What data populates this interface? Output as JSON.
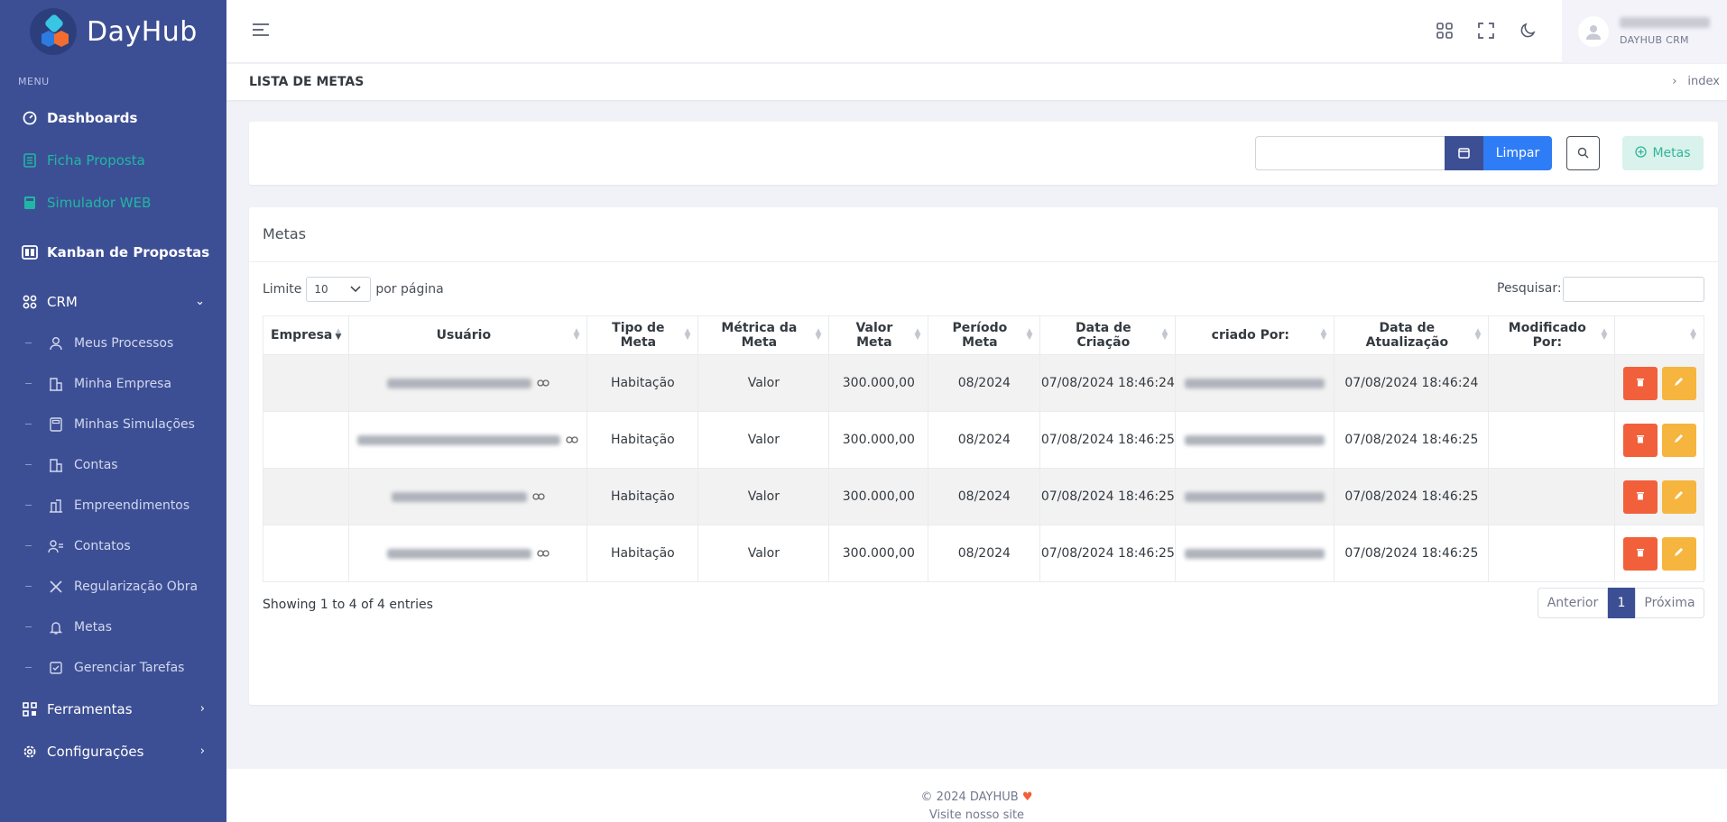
{
  "brand": {
    "name": "DayHub"
  },
  "sidebar": {
    "menu_title": "MENU",
    "items": [
      {
        "label": "Dashboards"
      },
      {
        "label": "Ficha Proposta"
      },
      {
        "label": "Simulador WEB"
      },
      {
        "label": "Kanban de Propostas"
      },
      {
        "label": "CRM"
      }
    ],
    "crm_sub": [
      {
        "label": "Meus Processos"
      },
      {
        "label": "Minha Empresa"
      },
      {
        "label": "Minhas Simulações"
      },
      {
        "label": "Contas"
      },
      {
        "label": "Empreendimentos"
      },
      {
        "label": "Contatos"
      },
      {
        "label": "Regularização Obra"
      },
      {
        "label": "Metas"
      },
      {
        "label": "Gerenciar Tarefas"
      }
    ],
    "bottom": [
      {
        "label": "Ferramentas"
      },
      {
        "label": "Configurações"
      }
    ]
  },
  "header": {
    "user_role": "DAYHUB CRM"
  },
  "breadcrumb": {
    "title": "LISTA DE METAS",
    "current": "index"
  },
  "filter": {
    "clear_label": "Limpar",
    "add_label": "Metas"
  },
  "table_card": {
    "title": "Metas",
    "limit_label": "Limite",
    "limit_value": "10",
    "per_page_label": "por página",
    "search_label": "Pesquisar:",
    "columns": [
      "Empresa",
      "Usuário",
      "Tipo de Meta",
      "Métrica da Meta",
      "Valor Meta",
      "Período Meta",
      "Data de Criação",
      "criado Por:",
      "Data de Atualização",
      "Modificado Por:",
      ""
    ],
    "rows": [
      {
        "tipo": "Habitação",
        "metrica": "Valor",
        "valor": "300.000,00",
        "periodo": "08/2024",
        "criacao": "07/08/2024 18:46:24",
        "atualizacao": "07/08/2024 18:46:24"
      },
      {
        "tipo": "Habitação",
        "metrica": "Valor",
        "valor": "300.000,00",
        "periodo": "08/2024",
        "criacao": "07/08/2024 18:46:25",
        "atualizacao": "07/08/2024 18:46:25"
      },
      {
        "tipo": "Habitação",
        "metrica": "Valor",
        "valor": "300.000,00",
        "periodo": "08/2024",
        "criacao": "07/08/2024 18:46:25",
        "atualizacao": "07/08/2024 18:46:25"
      },
      {
        "tipo": "Habitação",
        "metrica": "Valor",
        "valor": "300.000,00",
        "periodo": "08/2024",
        "criacao": "07/08/2024 18:46:25",
        "atualizacao": "07/08/2024 18:46:25"
      }
    ],
    "info": "Showing 1 to 4 of 4 entries",
    "pager": {
      "prev": "Anterior",
      "page": "1",
      "next": "Próxima"
    }
  },
  "footer": {
    "copyright": "© 2024 DAYHUB",
    "link": "Visite nosso site"
  },
  "colors": {
    "sidebar": "#3d4f94",
    "accent_teal": "#1fb7a4",
    "primary": "#2f7df6",
    "danger": "#f1603b",
    "warning": "#f6b53e"
  }
}
